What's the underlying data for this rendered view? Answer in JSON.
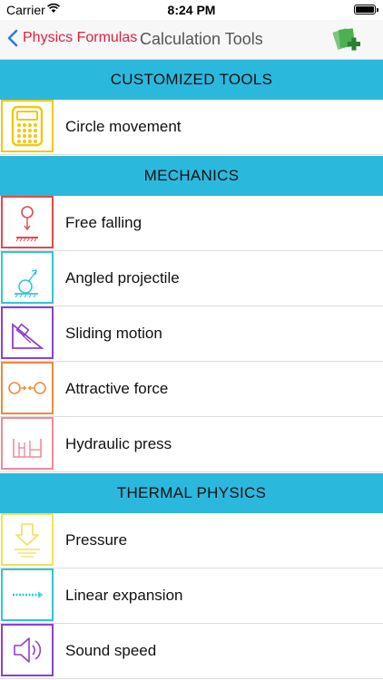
{
  "status": {
    "carrier": "Carrier",
    "time": "8:24 PM"
  },
  "nav": {
    "back_label": "Physics Formulas",
    "title": "Calculation Tools"
  },
  "sections": [
    {
      "title": "CUSTOMIZED TOOLS",
      "items": [
        {
          "label": "Circle movement",
          "icon": "calculator-icon",
          "color": "#f2c811"
        }
      ]
    },
    {
      "title": "MECHANICS",
      "items": [
        {
          "label": "Free falling",
          "icon": "free-fall-icon",
          "color": "#e5484d"
        },
        {
          "label": "Angled projectile",
          "icon": "projectile-icon",
          "color": "#2ec7d6"
        },
        {
          "label": "Sliding motion",
          "icon": "incline-icon",
          "color": "#8e3fd0"
        },
        {
          "label": "Attractive force",
          "icon": "attraction-icon",
          "color": "#f08a3a"
        },
        {
          "label": "Hydraulic press",
          "icon": "hydraulic-press-icon",
          "color": "#f08a9a"
        }
      ]
    },
    {
      "title": "THERMAL PHYSICS",
      "items": [
        {
          "label": "Pressure",
          "icon": "pressure-icon",
          "color": "#ede25a"
        },
        {
          "label": "Linear expansion",
          "icon": "linear-expansion-icon",
          "color": "#2ec7d6"
        },
        {
          "label": "Sound speed",
          "icon": "speaker-icon",
          "color": "#8e3fd0"
        }
      ]
    }
  ]
}
